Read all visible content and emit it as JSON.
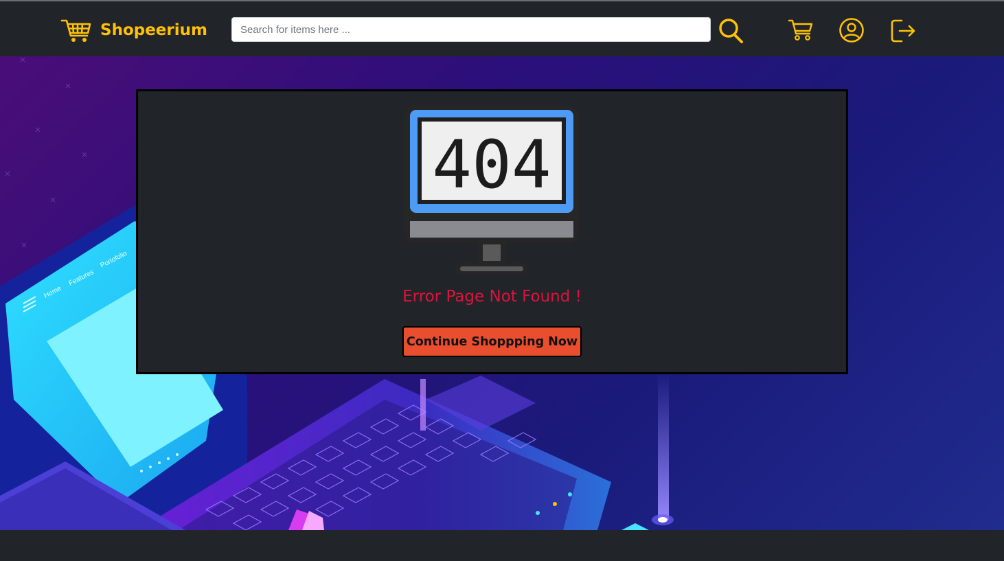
{
  "brand": {
    "name": "Shopeerium",
    "icon": "shopping-basket-icon"
  },
  "search": {
    "placeholder": "Search for items here ...",
    "value": "",
    "icon": "search-icon"
  },
  "nav": {
    "cart_icon": "cart-icon",
    "profile_icon": "user-circle-icon",
    "logout_icon": "logout-icon"
  },
  "hero": {
    "illustration": "isometric-laptop",
    "laptop_menu": [
      "Home",
      "Features",
      "Portofolio"
    ]
  },
  "error": {
    "code": "404",
    "message": "Error Page Not Found !",
    "button_label": "Continue Shoppping Now"
  },
  "colors": {
    "accent": "#ffc107",
    "navbar_bg": "#212529",
    "error_text": "#dc143c",
    "button_bg": "#e94e2e",
    "monitor_frame": "#4d9bf5"
  }
}
